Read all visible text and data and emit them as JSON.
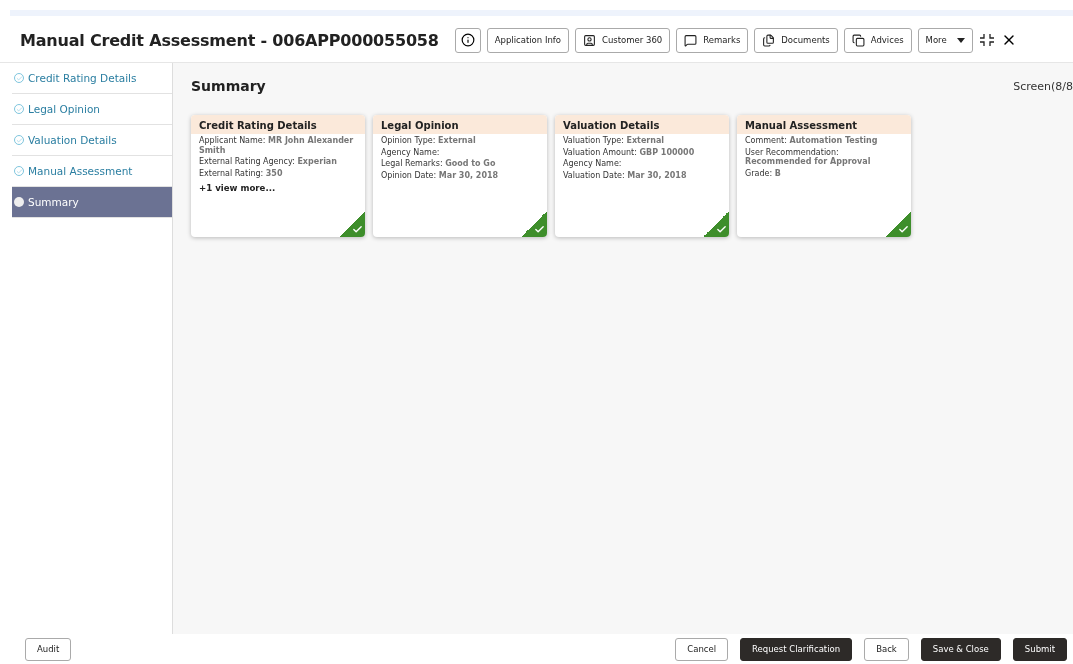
{
  "header": {
    "title": "Manual Credit Assessment - 006APP000055058",
    "buttons": [
      {
        "label": "Application Info"
      },
      {
        "label": "Customer 360"
      },
      {
        "label": "Remarks"
      },
      {
        "label": "Documents"
      },
      {
        "label": "Advices"
      },
      {
        "label": "More"
      }
    ]
  },
  "sidebar": {
    "items": [
      {
        "label": "Credit Rating Details",
        "selected": false,
        "completed": true
      },
      {
        "label": "Legal Opinion",
        "selected": false,
        "completed": true
      },
      {
        "label": "Valuation Details",
        "selected": false,
        "completed": true
      },
      {
        "label": "Manual Assessment",
        "selected": false,
        "completed": true
      },
      {
        "label": "Summary",
        "selected": true,
        "completed": false
      }
    ]
  },
  "main": {
    "title": "Summary",
    "screen_counter": "Screen(8/8",
    "cards": [
      {
        "title": "Credit Rating Details",
        "completed": true,
        "fields": [
          {
            "label": "Applicant Name:",
            "value": "MR John Alexander Smith"
          },
          {
            "label": "External Rating Agency:",
            "value": "Experian"
          },
          {
            "label": "External Rating:",
            "value": "350"
          }
        ],
        "more_link": "+1 view more..."
      },
      {
        "title": "Legal Opinion",
        "completed": true,
        "fields": [
          {
            "label": "Opinion Type:",
            "value": "External"
          },
          {
            "label": "Agency Name:"
          },
          {
            "label": "Legal Remarks:",
            "value": "Good to Go"
          },
          {
            "label": "Opinion Date:",
            "value": "Mar 30, 2018"
          }
        ]
      },
      {
        "title": "Valuation Details",
        "completed": true,
        "fields": [
          {
            "label": "Valuation Type:",
            "value": "External"
          },
          {
            "label": "Valuation Amount:",
            "value": "GBP 100000"
          },
          {
            "label": "Agency Name:"
          },
          {
            "label": "Valuation Date:",
            "value": "Mar 30, 2018"
          }
        ]
      },
      {
        "title": "Manual Assessment",
        "completed": true,
        "fields": [
          {
            "label": "Comment:",
            "value": "Automation Testing"
          },
          {
            "label": "User Recommendation:",
            "value": "Recommended for Approval"
          },
          {
            "label": "Grade:",
            "value": "B"
          }
        ]
      }
    ]
  },
  "footer": {
    "left_buttons": [
      {
        "label": "Audit",
        "kind": "outline"
      }
    ],
    "right_buttons": [
      {
        "label": "Cancel",
        "kind": "outline"
      },
      {
        "label": "Request Clarification",
        "kind": "dark"
      },
      {
        "label": "Back",
        "kind": "outline"
      },
      {
        "label": "Save & Close",
        "kind": "dark"
      },
      {
        "label": "Submit",
        "kind": "dark"
      }
    ]
  }
}
